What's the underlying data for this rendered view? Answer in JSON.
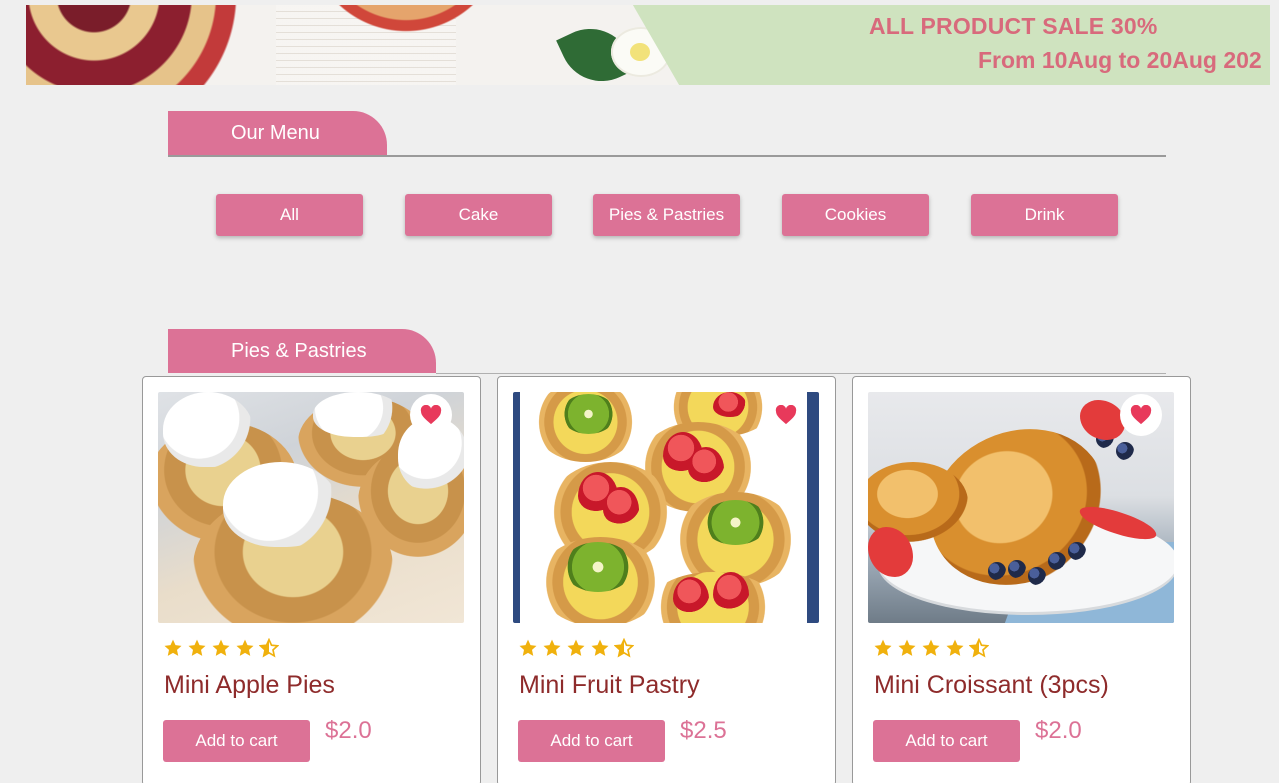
{
  "banner": {
    "line1": "ALL PRODUCT  SALE  30%",
    "line2": "From 10Aug to 20Aug 202",
    "accent": "#d86a7c",
    "background": "#cfe3bf"
  },
  "sections": {
    "menu_title": "Our Menu",
    "products_title": "Pies & Pastries"
  },
  "filters": [
    {
      "label": "All"
    },
    {
      "label": "Cake"
    },
    {
      "label": "Pies & Pastries"
    },
    {
      "label": "Cookies"
    },
    {
      "label": "Drink"
    }
  ],
  "products": [
    {
      "title": "Mini Apple Pies",
      "price": "$2.0",
      "rating": 4.5,
      "cart_label": "Add to cart",
      "image_icon": "apple-pie-image"
    },
    {
      "title": "Mini Fruit Pastry",
      "price": "$2.5",
      "rating": 4.5,
      "cart_label": "Add to cart",
      "image_icon": "fruit-pastry-image"
    },
    {
      "title": "Mini Croissant (3pcs)",
      "price": "$2.0",
      "rating": 4.5,
      "cart_label": "Add to cart",
      "image_icon": "croissant-image"
    }
  ],
  "colors": {
    "brand_pink": "#dc7296",
    "title_red": "#8e2b2b",
    "star_gold": "#f0b10d",
    "heart_red": "#e8395b"
  }
}
